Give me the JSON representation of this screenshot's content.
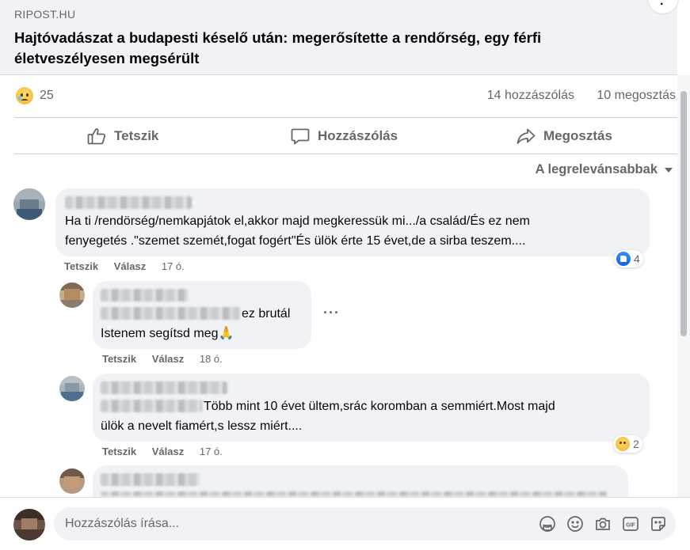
{
  "link_preview": {
    "source": "RIPOST.HU",
    "title": "Hajtóvadászat a budapesti késelő után: megerősítette a rendőrség, egy férfi életveszélyesen megsérült"
  },
  "stats": {
    "reaction_icon": "sad-emoji",
    "reaction_count": "25",
    "comments": "14 hozzászólás",
    "shares": "10 megosztás"
  },
  "actions": {
    "like": "Tetszik",
    "comment": "Hozzászólás",
    "share": "Megosztás"
  },
  "sort_label": "A legrelevánsabbak",
  "comments": [
    {
      "text_line1": "Ha ti /rendörség/nemkapjátok el,akkor majd megkeressük mi.../a család/És ez nem",
      "text_line2": "fenyegetés .\"szemet szemét,fogat fogért\"És ülök érte 15 évet,de a sirba teszem....",
      "like": "Tetszik",
      "reply": "Válasz",
      "time": "17 ó.",
      "reaction_icon": "like-icon",
      "reaction_count": "4"
    },
    {
      "text_line1": "ez brutál",
      "text_line2": "Istenem segítsd meg🙏",
      "like": "Tetszik",
      "reply": "Válasz",
      "time": "18 ó.",
      "more": "···"
    },
    {
      "text_line1": "Több mint 10 évet ültem,srác koromban a semmiért.Most majd",
      "text_line2": "ülök a nevelt fiamért,s lessz miért....",
      "like": "Tetszik",
      "reply": "Válasz",
      "time": "17 ó.",
      "reaction_icon": "sad-icon",
      "reaction_count": "2"
    }
  ],
  "compose": {
    "placeholder": "Hozzászólás írása...",
    "icons": [
      "avatar-sticker-icon",
      "emoji-icon",
      "camera-icon",
      "gif-icon",
      "sticker-icon"
    ]
  },
  "colors": {
    "secondary_text": "#65676b",
    "bubble": "#f0f2f5",
    "like_blue": "#0b66e4"
  }
}
